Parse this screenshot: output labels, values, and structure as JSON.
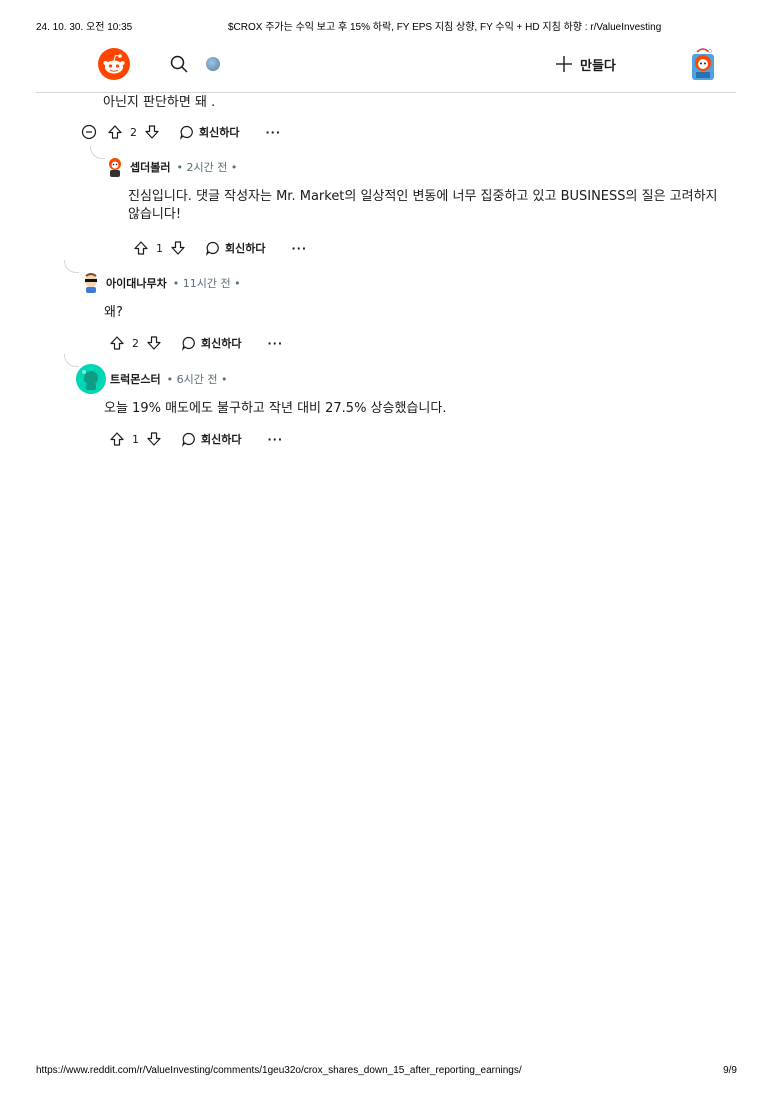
{
  "print": {
    "date": "24. 10. 30. 오전 10:35",
    "title": "$CROX 주가는 수익 보고 후 15% 하락, FY EPS 지침 상향, FY 수익 + HD 지침 하향 : r/ValueInvesting",
    "url": "https://www.reddit.com/r/ValueInvesting/comments/1geu32o/crox_shares_down_15_after_reporting_earnings/",
    "pages": "9/9"
  },
  "header": {
    "create_label": "만들다"
  },
  "colors": {
    "brand": "#ff4500",
    "meta": "#576f76",
    "divider": "#d6d6d6"
  },
  "comments": {
    "c0": {
      "text": "아닌지 판단하면 돼 .",
      "score": "2",
      "reply": "회신하다",
      "more": "···"
    },
    "c1": {
      "author": "셉더볼러",
      "meta": "• 2시간 전 •",
      "text": "진심입니다. 댓글 작성자는 Mr. Market의 일상적인 변동에 너무 집중하고 있고 BUSINESS의 질은 고려하지 않습니다!",
      "score": "1",
      "reply": "회신하다",
      "more": "···"
    },
    "c2": {
      "author": "아이대나무차",
      "meta": "• 11시간 전 •",
      "text": "왜?",
      "score": "2",
      "reply": "회신하다",
      "more": "···"
    },
    "c3": {
      "author": "트럭몬스터",
      "meta": "• 6시간 전 •",
      "text": "오늘 19% 매도에도 불구하고 작년 대비 27.5% 상승했습니다.",
      "score": "1",
      "reply": "회신하다",
      "more": "···"
    }
  }
}
